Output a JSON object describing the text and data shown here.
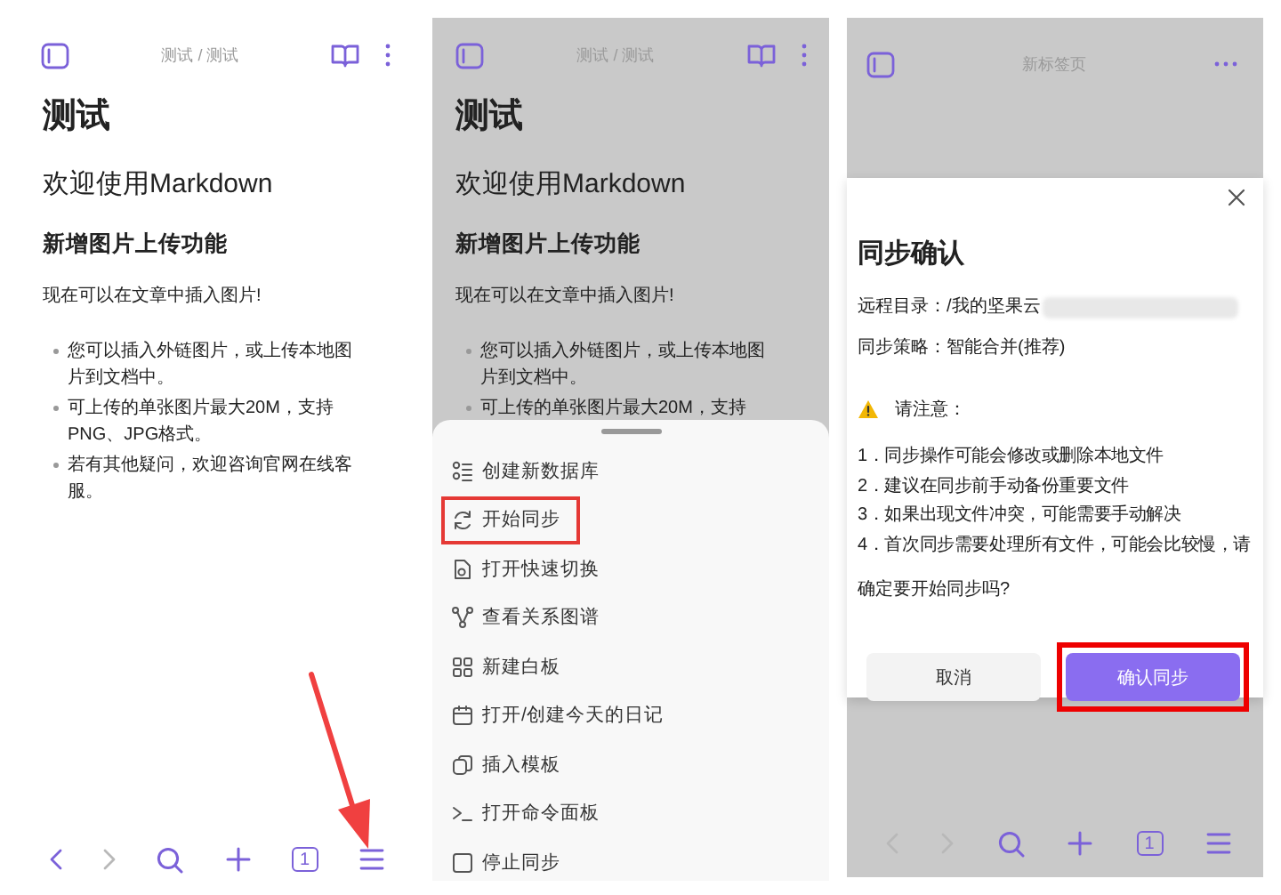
{
  "editor_screen": {
    "dimmed": false,
    "breadcrumb": "测试 / 测试",
    "note": {
      "title": "测试",
      "heading": "欢迎使用Markdown",
      "subheading": "新增图片上传功能",
      "paragraph": "现在可以在文章中插入图片!",
      "bullets": [
        "您可以插入外链图片，或上传本地图片到文档中。",
        "可上传的单张图片最大20M，支持PNG、JPG格式。",
        "若有其他疑问，欢迎咨询官网在线客服。"
      ]
    },
    "toolbar": {
      "back_enabled": true,
      "forward_enabled": false,
      "tab_count": "1"
    },
    "annotation": {
      "kind": "arrow"
    }
  },
  "menu_screen": {
    "dimmed": true,
    "breadcrumb": "测试 / 测试",
    "note": {
      "title": "测试",
      "heading": "欢迎使用Markdown",
      "subheading": "新增图片上传功能",
      "paragraph": "现在可以在文章中插入图片!",
      "bullets": [
        "您可以插入外链图片，或上传本地图片到文档中。",
        "可上传的单张图片最大20M，支持"
      ]
    },
    "menu_items": [
      {
        "label": "创建新数据库",
        "kind": "database",
        "highlighted": false
      },
      {
        "label": "开始同步",
        "kind": "sync",
        "highlighted": true
      },
      {
        "label": "打开快速切换",
        "kind": "switch",
        "highlighted": false
      },
      {
        "label": "查看关系图谱",
        "kind": "graph",
        "highlighted": false
      },
      {
        "label": "新建白板",
        "kind": "board",
        "highlighted": false
      },
      {
        "label": "打开/创建今天的日记",
        "kind": "calendar",
        "highlighted": false
      },
      {
        "label": "插入模板",
        "kind": "template",
        "highlighted": false
      },
      {
        "label": "打开命令面板",
        "kind": "terminal",
        "highlighted": false
      },
      {
        "label": "停止同步",
        "kind": "stop",
        "highlighted": false
      }
    ]
  },
  "dialog_screen": {
    "dimmed": true,
    "tab_title": "新标签页",
    "dialog": {
      "title": "同步确认",
      "fields": [
        {
          "label": "远程目录：",
          "value": "/我的坚果云",
          "redacted": true
        },
        {
          "label": "同步策略：",
          "value": "智能合并(推荐)"
        }
      ],
      "warning": "请注意：",
      "notes": [
        "1．同步操作可能会修改或删除本地文件",
        "2．建议在同步前手动备份重要文件",
        "3．如果出现文件冲突，可能需要手动解决",
        "4．首次同步需要处理所有文件，可能会比较慢，请"
      ],
      "question": "确定要开始同步吗?",
      "buttons": [
        {
          "label": "取消",
          "kind": "secondary",
          "highlighted": false
        },
        {
          "label": "确认同步",
          "kind": "primary",
          "highlighted": true
        }
      ]
    },
    "toolbar": {
      "back_enabled": false,
      "forward_enabled": false,
      "tab_count": "1"
    }
  }
}
